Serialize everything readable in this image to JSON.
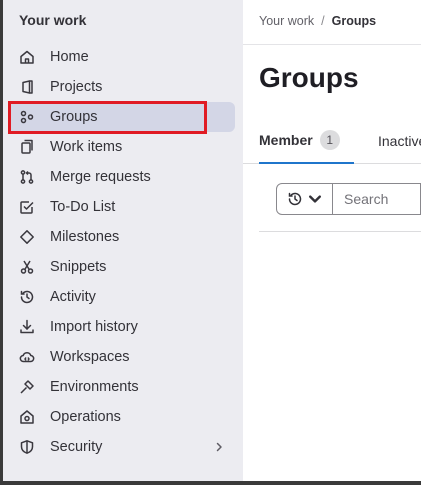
{
  "sidebar": {
    "title": "Your work",
    "items": [
      {
        "label": "Home",
        "icon": "home-icon"
      },
      {
        "label": "Projects",
        "icon": "project-icon"
      },
      {
        "label": "Groups",
        "icon": "group-icon",
        "active": true
      },
      {
        "label": "Work items",
        "icon": "work-items-icon"
      },
      {
        "label": "Merge requests",
        "icon": "merge-request-icon"
      },
      {
        "label": "To-Do List",
        "icon": "todo-icon"
      },
      {
        "label": "Milestones",
        "icon": "milestone-icon"
      },
      {
        "label": "Snippets",
        "icon": "snippet-icon"
      },
      {
        "label": "Activity",
        "icon": "history-icon"
      },
      {
        "label": "Import history",
        "icon": "import-icon"
      },
      {
        "label": "Workspaces",
        "icon": "workspace-icon"
      },
      {
        "label": "Environments",
        "icon": "environment-icon"
      },
      {
        "label": "Operations",
        "icon": "operations-icon"
      },
      {
        "label": "Security",
        "icon": "shield-icon"
      }
    ]
  },
  "breadcrumb": {
    "parent": "Your work",
    "separator": "/",
    "current": "Groups"
  },
  "page": {
    "title": "Groups"
  },
  "tabs": {
    "member_label": "Member",
    "member_count": "1",
    "inactive_label": "Inactive"
  },
  "filter": {
    "search_placeholder": "Search",
    "sort_icon": "history-icon"
  },
  "colors": {
    "sidebar_bg": "#ececf1",
    "active_item_bg": "#d3d6e6",
    "highlight_border": "#e01b24",
    "active_tab_underline": "#1f75cb"
  }
}
